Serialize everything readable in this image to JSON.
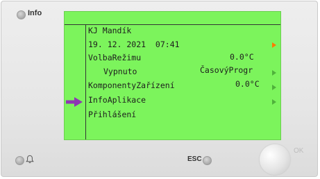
{
  "device": {
    "info_label": "Info",
    "esc_label": "ESC",
    "ok_label": "OK"
  },
  "lcd": {
    "title": "KJ Mandík",
    "date_time": "19. 12. 2021  07:41",
    "top_temp": "0.0°C",
    "items": [
      {
        "label": "VolbaRežimu",
        "value": "ČasovýProgr",
        "arrow": "orange"
      },
      {
        "label": "Vypnuto",
        "value": "0.0°C",
        "arrow": "none"
      },
      {
        "label": "KomponentyZařízení",
        "value": "",
        "arrow": "green"
      },
      {
        "label": "InfoAplikace",
        "value": "",
        "arrow": "green"
      },
      {
        "label": "Přihlášení",
        "value": "",
        "arrow": "green"
      }
    ],
    "pointer_color": "#8e36b4",
    "screen_color": "#7cf45c"
  }
}
